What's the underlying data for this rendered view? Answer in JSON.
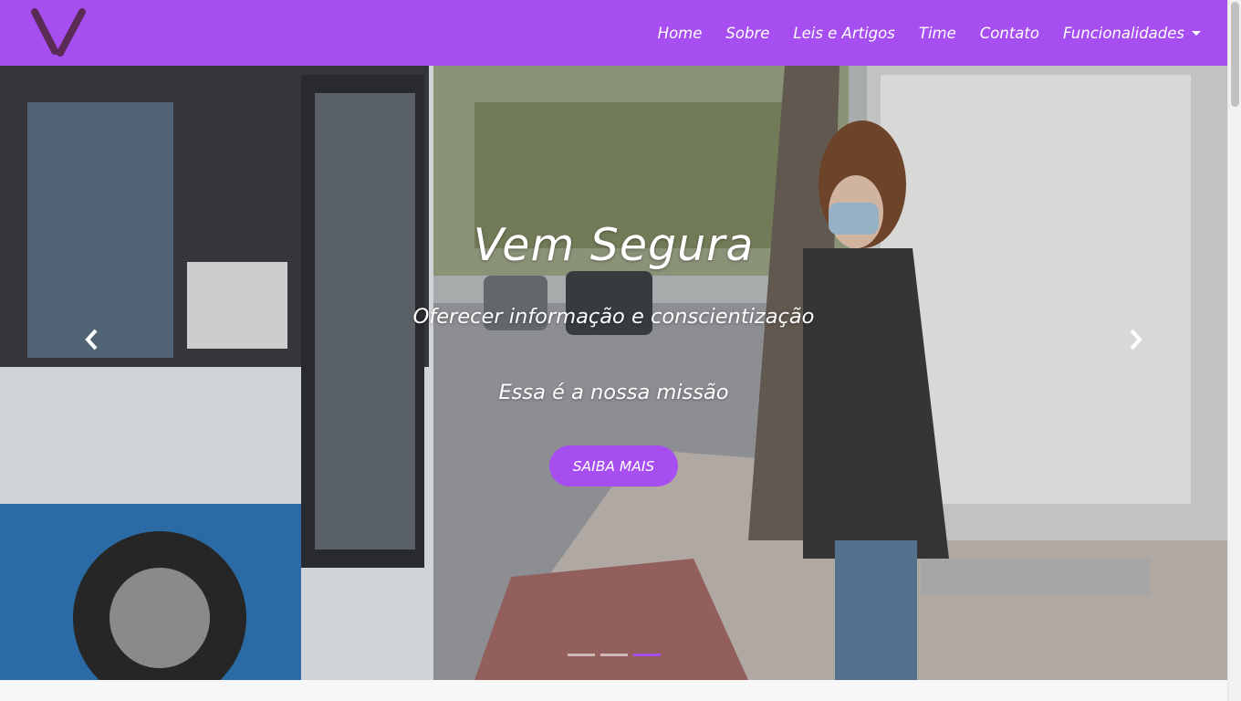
{
  "navbar": {
    "brand_icon": "v-logo-icon",
    "brand_color": "#5a2b54",
    "background": "#a64ef0",
    "links": [
      {
        "label": "Home"
      },
      {
        "label": "Sobre"
      },
      {
        "label": "Leis e Artigos"
      },
      {
        "label": "Time"
      },
      {
        "label": "Contato"
      }
    ],
    "dropdown_label": "Funcionalidades"
  },
  "hero": {
    "title": "Vem Segura",
    "subtitle": "Oferecer informação e conscientização",
    "mission": "Essa é a nossa missão",
    "cta_label": "SAIBA MAIS",
    "prev_icon": "chevron-left-icon",
    "next_icon": "chevron-right-icon",
    "indicators": 3,
    "active_indicator": 3,
    "accent": "#a64ef0"
  }
}
